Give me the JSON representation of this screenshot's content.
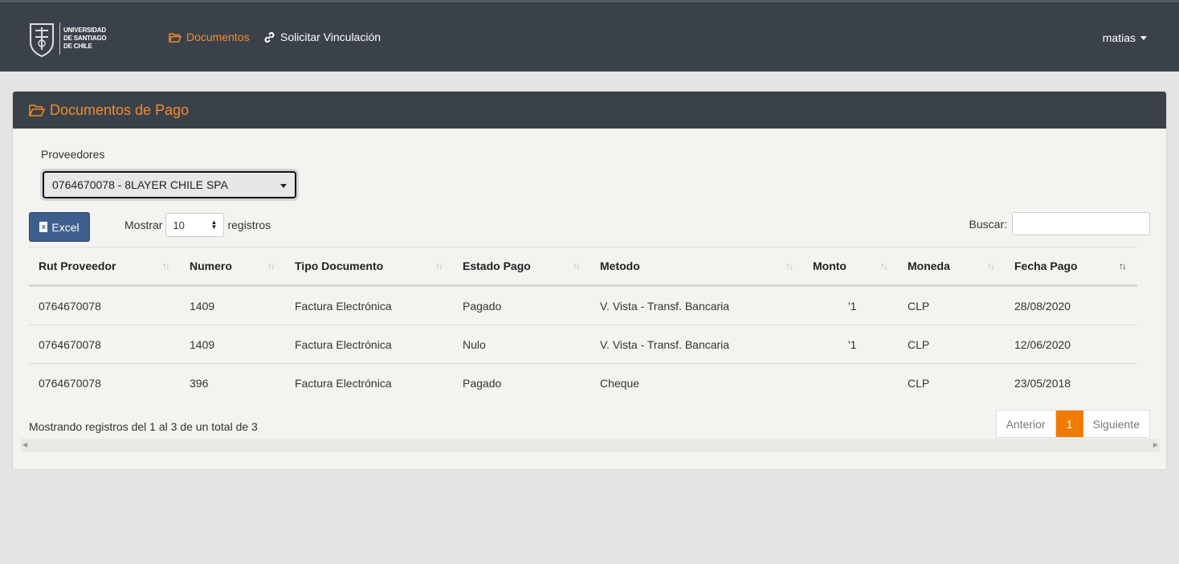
{
  "logo": {
    "line1": "UNIVERSIDAD",
    "line2": "DE SANTIAGO",
    "line3": "DE CHILE"
  },
  "nav": {
    "documentos": "Documentos",
    "vinculacion": "Solicitar Vinculación",
    "user": "matias"
  },
  "card": {
    "title": "Documentos de Pago"
  },
  "proveedores": {
    "label": "Proveedores",
    "selected": "0764670078 - 8LAYER CHILE SPA"
  },
  "toolbar": {
    "excel_label": "Excel",
    "mostrar": "Mostrar",
    "length_value": "10",
    "registros": "registros",
    "buscar": "Buscar:"
  },
  "table": {
    "columns": [
      "Rut Proveedor",
      "Numero",
      "Tipo Documento",
      "Estado Pago",
      "Metodo",
      "Monto",
      "Moneda",
      "Fecha Pago"
    ],
    "rows": [
      [
        "0764670078",
        "1409",
        "Factura Electrónica",
        "Pagado",
        "V. Vista - Transf. Bancaria",
        "'1",
        "CLP",
        "28/08/2020"
      ],
      [
        "0764670078",
        "1409",
        "Factura Electrónica",
        "Nulo",
        "V. Vista - Transf. Bancaria",
        "'1",
        "CLP",
        "12/06/2020"
      ],
      [
        "0764670078",
        "396",
        "Factura Electrónica",
        "Pagado",
        "Cheque",
        "",
        "CLP",
        "23/05/2018"
      ]
    ]
  },
  "footer": {
    "info": "Mostrando registros del 1 al 3 de un total de 3",
    "prev": "Anterior",
    "page": "1",
    "next": "Siguiente"
  },
  "colors": {
    "accent": "#f28c28",
    "navbar": "#3b414a",
    "excel": "#3e5e8d",
    "page_active": "#ef7c00"
  }
}
